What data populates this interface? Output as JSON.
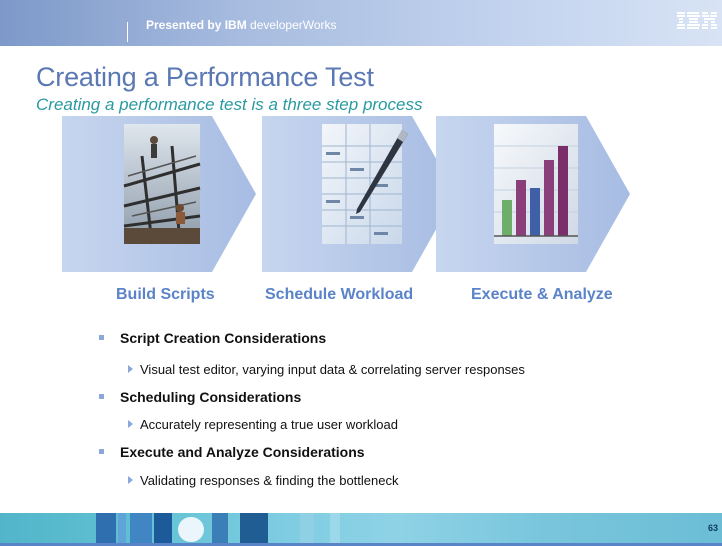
{
  "banner": {
    "presented_bold": "Presented by IBM",
    "presented_rest": " developerWorks",
    "logo_text": "IBM"
  },
  "slide": {
    "title": "Creating a Performance Test",
    "subtitle": "Creating a performance test is a three step process"
  },
  "steps": [
    {
      "label": "Build Scripts",
      "image": "construction-workers-photo"
    },
    {
      "label": "Schedule Workload",
      "image": "pen-on-spreadsheet-photo"
    },
    {
      "label": "Execute & Analyze",
      "image": "bar-chart-photo"
    }
  ],
  "bullets": [
    {
      "heading": "Script Creation Considerations",
      "detail": "Visual test editor, varying input data & correlating server responses"
    },
    {
      "heading": "Scheduling Considerations",
      "detail": "Accurately representing a true user workload"
    },
    {
      "heading": "Execute and Analyze Considerations",
      "detail": "Validating responses & finding the bottleneck"
    }
  ],
  "footer": {
    "page_number": "63"
  },
  "colors": {
    "title": "#5a78b3",
    "subtitle": "#2a9aa0",
    "step_label": "#5a83c8",
    "bullet_marker": "#8aa9d6",
    "footer": "#62c1d4"
  }
}
